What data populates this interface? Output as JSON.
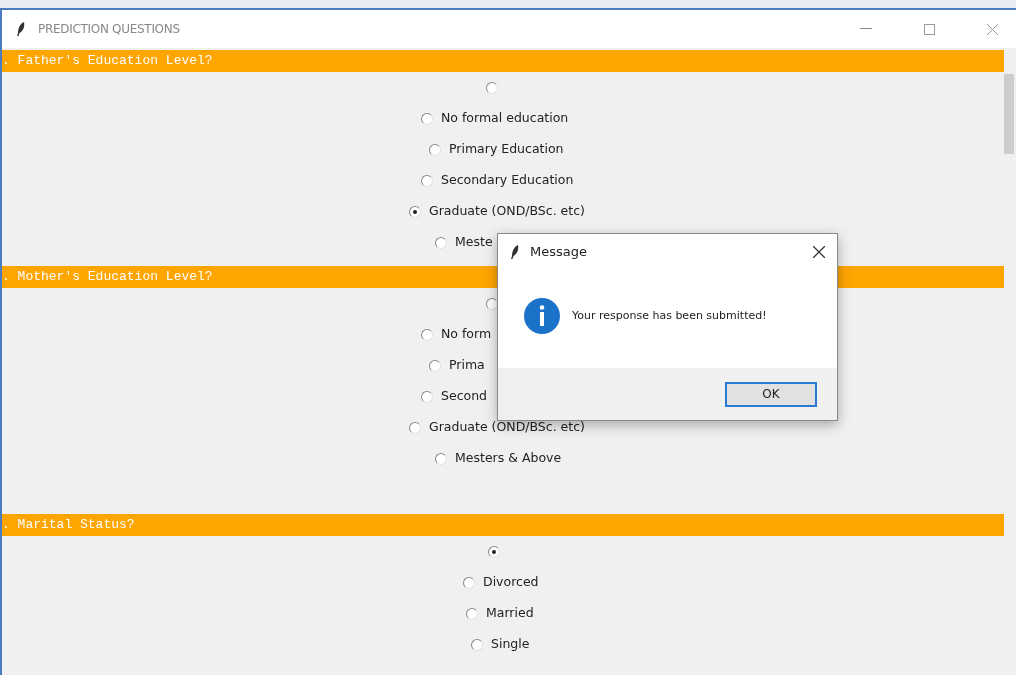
{
  "window": {
    "title": "PREDICTION QUESTIONS"
  },
  "questions": [
    {
      "heading": ". Father's Education Level?",
      "kind": "education",
      "options": [
        {
          "selected": false
        },
        {
          "label": "No formal education",
          "selected": false
        },
        {
          "label": "Primary Education",
          "selected": false
        },
        {
          "label": "Secondary Education",
          "selected": false
        },
        {
          "label": "Graduate (OND/BSc. etc)",
          "selected": true
        },
        {
          "label": "Meste",
          "selected": false
        }
      ]
    },
    {
      "heading": ". Mother's Education Level?",
      "kind": "education",
      "options": [
        {
          "selected": false
        },
        {
          "label": "No form",
          "selected": false
        },
        {
          "label": "Prima",
          "selected": false
        },
        {
          "label": "Second",
          "selected": false
        },
        {
          "label": "Graduate (OND/BSc. etc)",
          "selected": false
        },
        {
          "label": "Mesters & Above",
          "selected": false
        }
      ]
    },
    {
      "heading": ". Marital Status?",
      "kind": "marital",
      "options": [
        {
          "selected": true
        },
        {
          "label": "Divorced",
          "selected": false
        },
        {
          "label": "Married",
          "selected": false
        },
        {
          "label": "Single",
          "selected": false
        }
      ]
    }
  ],
  "dialog": {
    "title": "Message",
    "message": "Your response has been submitted!",
    "button": "OK"
  }
}
